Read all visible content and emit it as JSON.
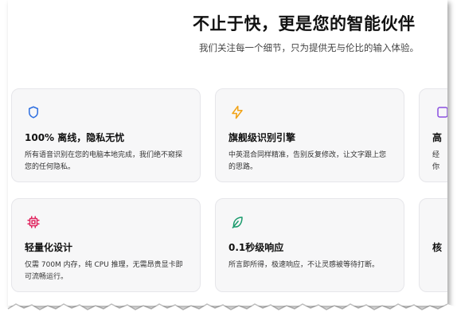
{
  "hero": {
    "title": "不止于快，更是您的智能伙伴",
    "subtitle": "我们关注每一个细节，只为提供无与伦比的输入体验。"
  },
  "cards": [
    {
      "icon": "shield-icon",
      "icon_color": "#2f6fe0",
      "title": "100% 离线，隐私无忧",
      "desc": "所有语音识别在您的电脑本地完成，我们绝不窥探您的任何隐私。"
    },
    {
      "icon": "lightning-icon",
      "icon_color": "#f2a316",
      "title": "旗舰级识别引擎",
      "desc": "中英混合同样精准，告别反复修改，让文字跟上您的思路。"
    },
    {
      "icon": "chip-icon",
      "icon_color": "#e0245e",
      "title": "轻量化设计",
      "desc": "仅需 700M 内存，纯 CPU 推理，无需昂贵显卡即可流畅运行。"
    },
    {
      "icon": "feather-icon",
      "icon_color": "#1a9b6c",
      "title": "0.1秒级响应",
      "desc": "所言即所得，极速响应，不让灵感被等待打断。"
    }
  ],
  "cut_off": {
    "top_right_title_char": "高",
    "top_right_desc_1": "经",
    "top_right_desc_2": "你",
    "bottom_right_title_char": "核"
  }
}
